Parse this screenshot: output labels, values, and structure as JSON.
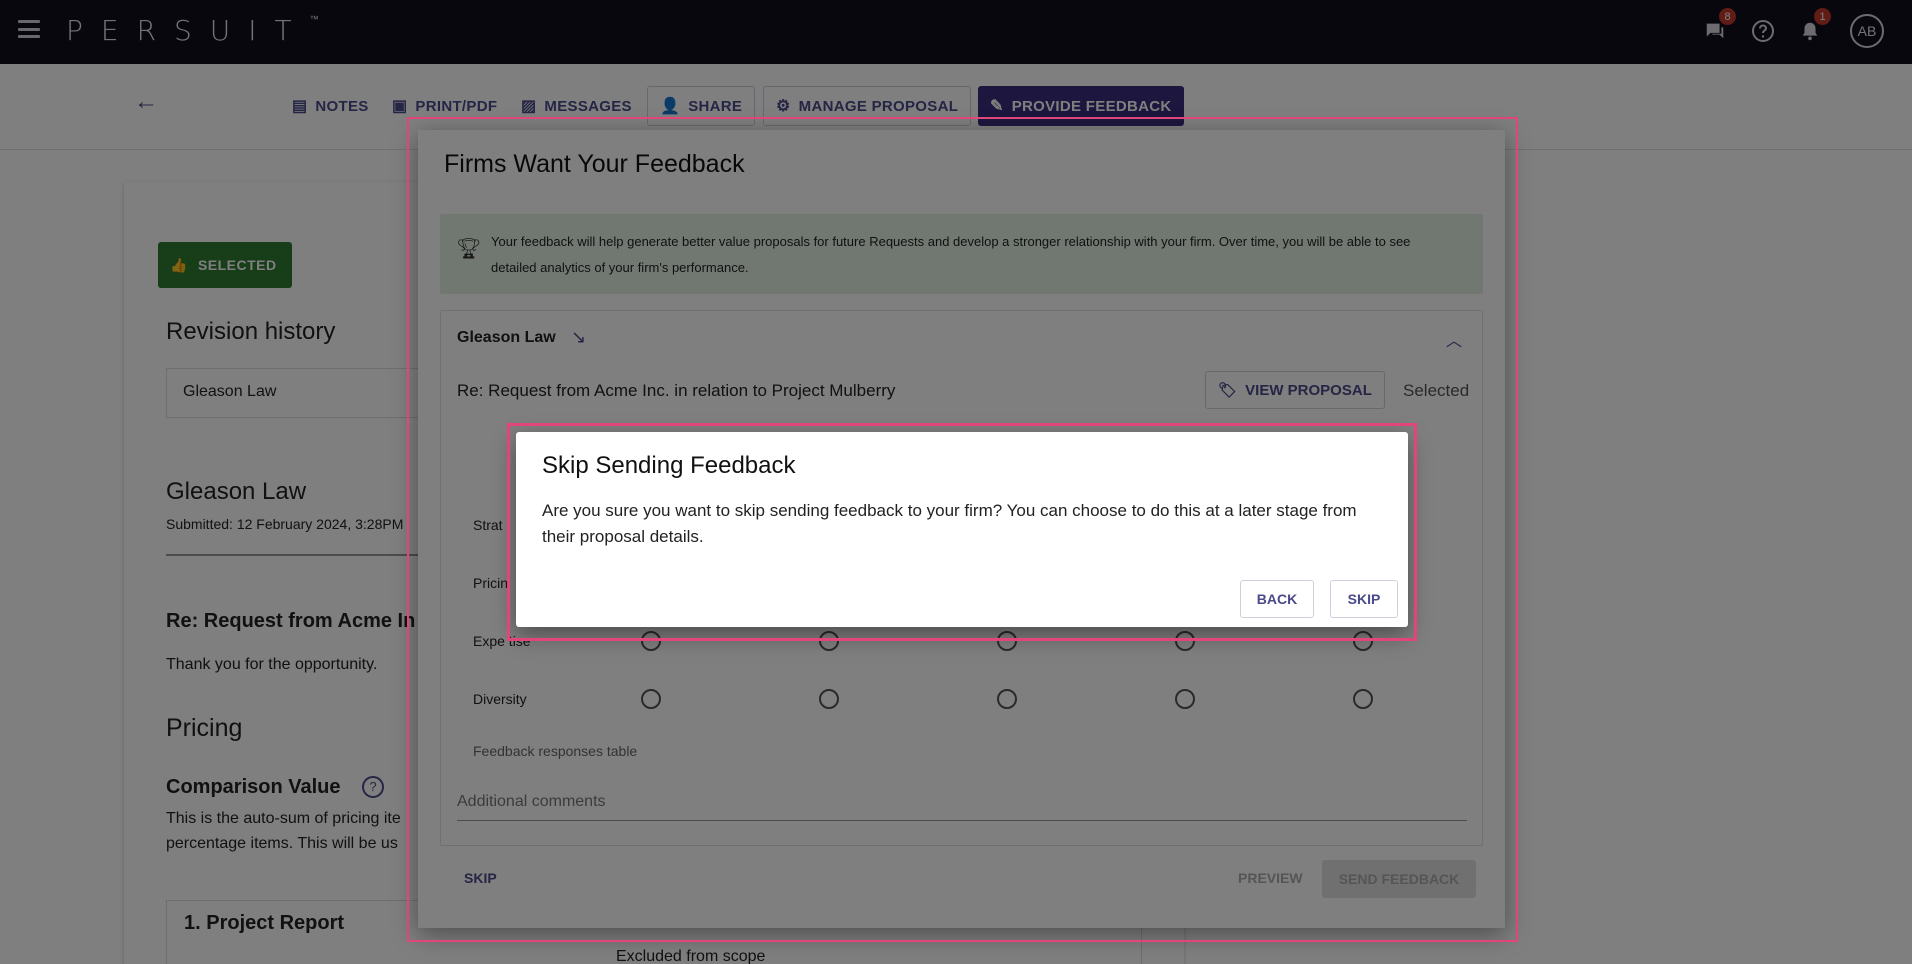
{
  "topbar": {
    "logo": "PERSUIT",
    "logo_tm": "™",
    "messages_badge": "8",
    "notifications_badge": "1",
    "avatar_initials": "AB"
  },
  "actions": {
    "notes": "NOTES",
    "print": "PRINT/PDF",
    "messages": "MESSAGES",
    "share": "SHARE",
    "manage": "MANAGE PROPOSAL",
    "feedback": "PROVIDE FEEDBACK"
  },
  "left": {
    "selected_chip": "SELECTED",
    "revision_history": "Revision history",
    "revision_select": "Gleason Law",
    "firm": "Gleason Law",
    "submitted": "Submitted: 12 February 2024, 3:28PM",
    "re": "Re: Request from Acme In",
    "thanks": "Thank you for the opportunity.",
    "pricing": "Pricing",
    "comparison": "Comparison Value",
    "auto_sum_1": "This is the auto-sum of pricing ite",
    "auto_sum_2": "percentage items. This will be us",
    "project": "1. Project Report",
    "excluded": "Excluded from scope"
  },
  "feedback": {
    "title": "Firms Want Your Feedback",
    "info": "Your feedback will help generate better value proposals for future Requests and develop a stronger relationship with your firm. Over time, you will be able to see detailed analytics of your firm's performance.",
    "firm": "Gleason Law",
    "re": "Re: Request from Acme Inc. in relation to Project Mulberry",
    "view_proposal": "VIEW PROPOSAL",
    "status": "Selected",
    "rows": [
      "Strat",
      "Pricin",
      "Expe tise",
      "Diversity"
    ],
    "table_caption": "Feedback responses table",
    "comments_placeholder": "Additional comments",
    "skip": "SKIP",
    "preview": "PREVIEW",
    "send": "SEND FEEDBACK"
  },
  "skip_dialog": {
    "title": "Skip Sending Feedback",
    "body": "Are you sure you want to skip sending feedback to your firm? You can choose to do this at a later stage from their proposal details.",
    "back": "BACK",
    "skip": "SKIP"
  }
}
